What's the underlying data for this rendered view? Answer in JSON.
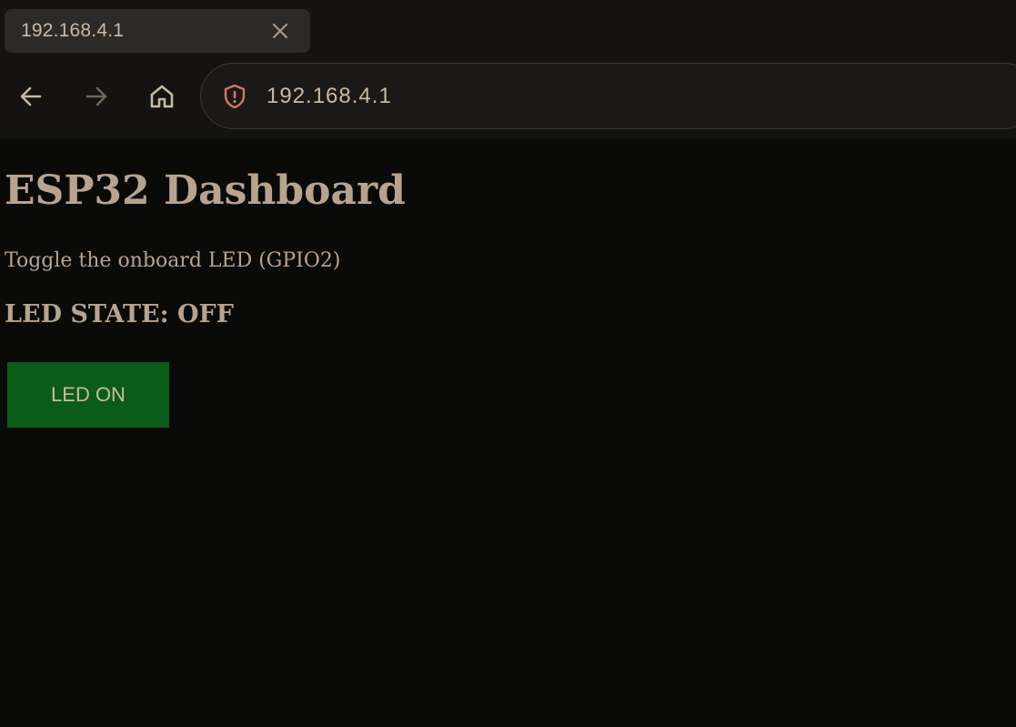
{
  "browser": {
    "tab_title": "192.168.4.1",
    "url": "192.168.4.1",
    "icons": {
      "tab_close": "close-icon",
      "back": "arrow-left-icon",
      "forward": "arrow-right-icon",
      "home": "home-icon",
      "security": "shield-warning-icon"
    },
    "colors": {
      "chrome_bg": "#141312",
      "tab_bg": "#2c2a27",
      "shield": "#d0766a"
    }
  },
  "page": {
    "title": "ESP32 Dashboard",
    "subtitle": "Toggle the onboard LED (GPIO2)",
    "state_label": "LED STATE: OFF",
    "button_label": "LED ON",
    "colors": {
      "background": "#0a0a09",
      "text": "#b7a48e",
      "button": "#0a5c18"
    }
  }
}
